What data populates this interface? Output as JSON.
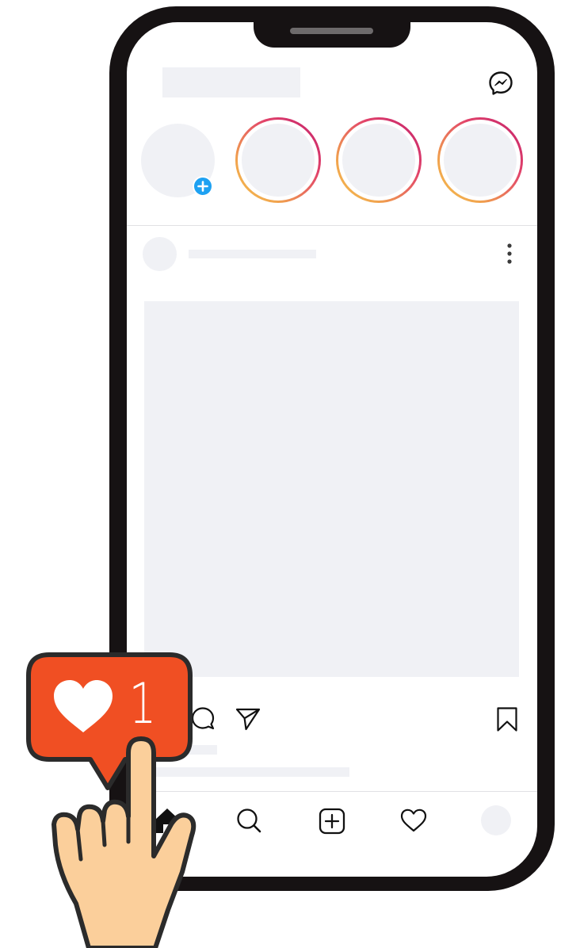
{
  "status_bar": {},
  "header": {
    "logo": "instagram-logo-placeholder",
    "messenger_icon": "messenger-icon"
  },
  "stories": {
    "own_story": {
      "badge_icon": "add-story-plus-icon"
    },
    "items": [
      {
        "ring_colors": [
          "#c21f6c",
          "#f5c04f"
        ]
      },
      {
        "ring_colors": [
          "#c21f6c",
          "#f5c04f"
        ]
      },
      {
        "ring_colors": [
          "#c21f6c",
          "#f5c04f"
        ]
      }
    ]
  },
  "post": {
    "more_icon": "more-vertical-icon",
    "actions": [
      "like-icon",
      "comment-icon",
      "share-icon",
      "bookmark-icon"
    ]
  },
  "bottom_nav": {
    "items": [
      "home-icon",
      "search-icon",
      "new-post-icon",
      "activity-heart-icon",
      "profile-avatar"
    ]
  },
  "notification": {
    "count": "1",
    "icon": "heart-icon"
  },
  "colors": {
    "placeholder": "#f0f1f5",
    "phone_frame": "#161213",
    "notification_badge": "#f04f23",
    "add_story_blue": "#1ea1f2",
    "hand_skin": "#fbcf9b",
    "story_ring_start": "#c21f6c",
    "story_ring_end": "#f5c04f"
  }
}
